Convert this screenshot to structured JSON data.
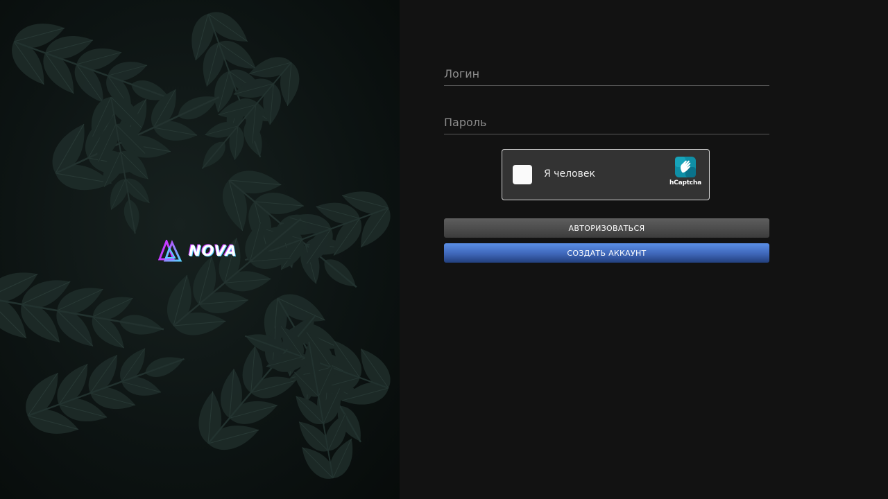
{
  "logo": {
    "text": "NOVA"
  },
  "form": {
    "login_placeholder": "Логин",
    "password_placeholder": "Пароль"
  },
  "captcha": {
    "label": "Я человек",
    "brand": "hCaptcha"
  },
  "buttons": {
    "login_label": "АВТОРИЗОВАТЬСЯ",
    "register_label": "СОЗДАТЬ АККАУНТ"
  },
  "colors": {
    "background": "#121212",
    "login_button": "#4a4a4a",
    "register_button": "#3e66b8",
    "captcha_teal": "#0f8fa6"
  }
}
